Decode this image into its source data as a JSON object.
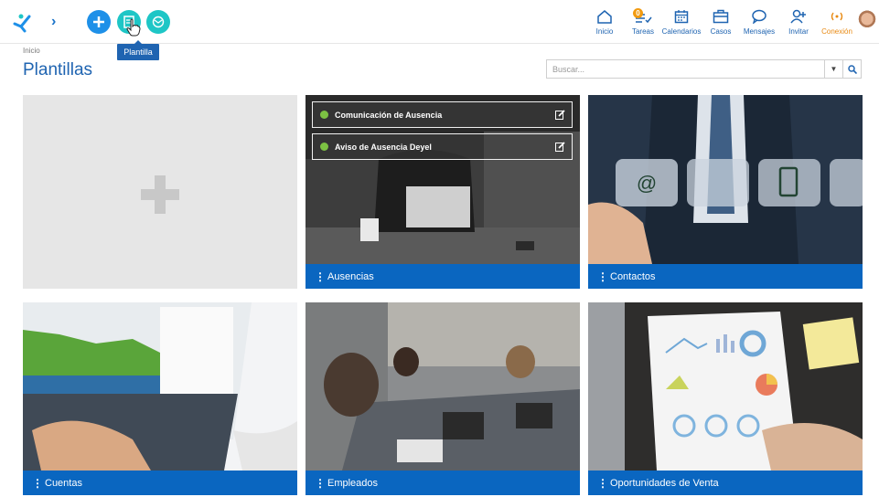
{
  "header": {
    "add_icon": "plus-icon",
    "template_icon": "template-icon",
    "template2_icon": "globe-icon",
    "tooltip": "Plantilla",
    "nav": [
      {
        "label": "Inicio",
        "icon": "home-icon"
      },
      {
        "label": "Tareas",
        "icon": "tasks-icon",
        "badge": "0"
      },
      {
        "label": "Calendarios",
        "icon": "calendar-icon"
      },
      {
        "label": "Casos",
        "icon": "briefcase-icon"
      },
      {
        "label": "Mensajes",
        "icon": "message-icon"
      },
      {
        "label": "Invitar",
        "icon": "invite-icon"
      },
      {
        "label": "Conexión",
        "icon": "connection-icon"
      }
    ]
  },
  "breadcrumb": "Inicio",
  "title": "Plantillas",
  "search": {
    "placeholder": "Buscar..."
  },
  "cards": [
    {
      "label": "",
      "type": "add"
    },
    {
      "label": "Ausencias",
      "templates": [
        "Comunicación de Ausencia",
        "Aviso de Ausencia Deyel"
      ]
    },
    {
      "label": "Contactos"
    },
    {
      "label": "Cuentas"
    },
    {
      "label": "Empleados"
    },
    {
      "label": "Oportunidades de Venta"
    }
  ],
  "colors": {
    "primary": "#0a66c0",
    "accent": "#1ec6c6",
    "brand": "#1e90e8"
  }
}
